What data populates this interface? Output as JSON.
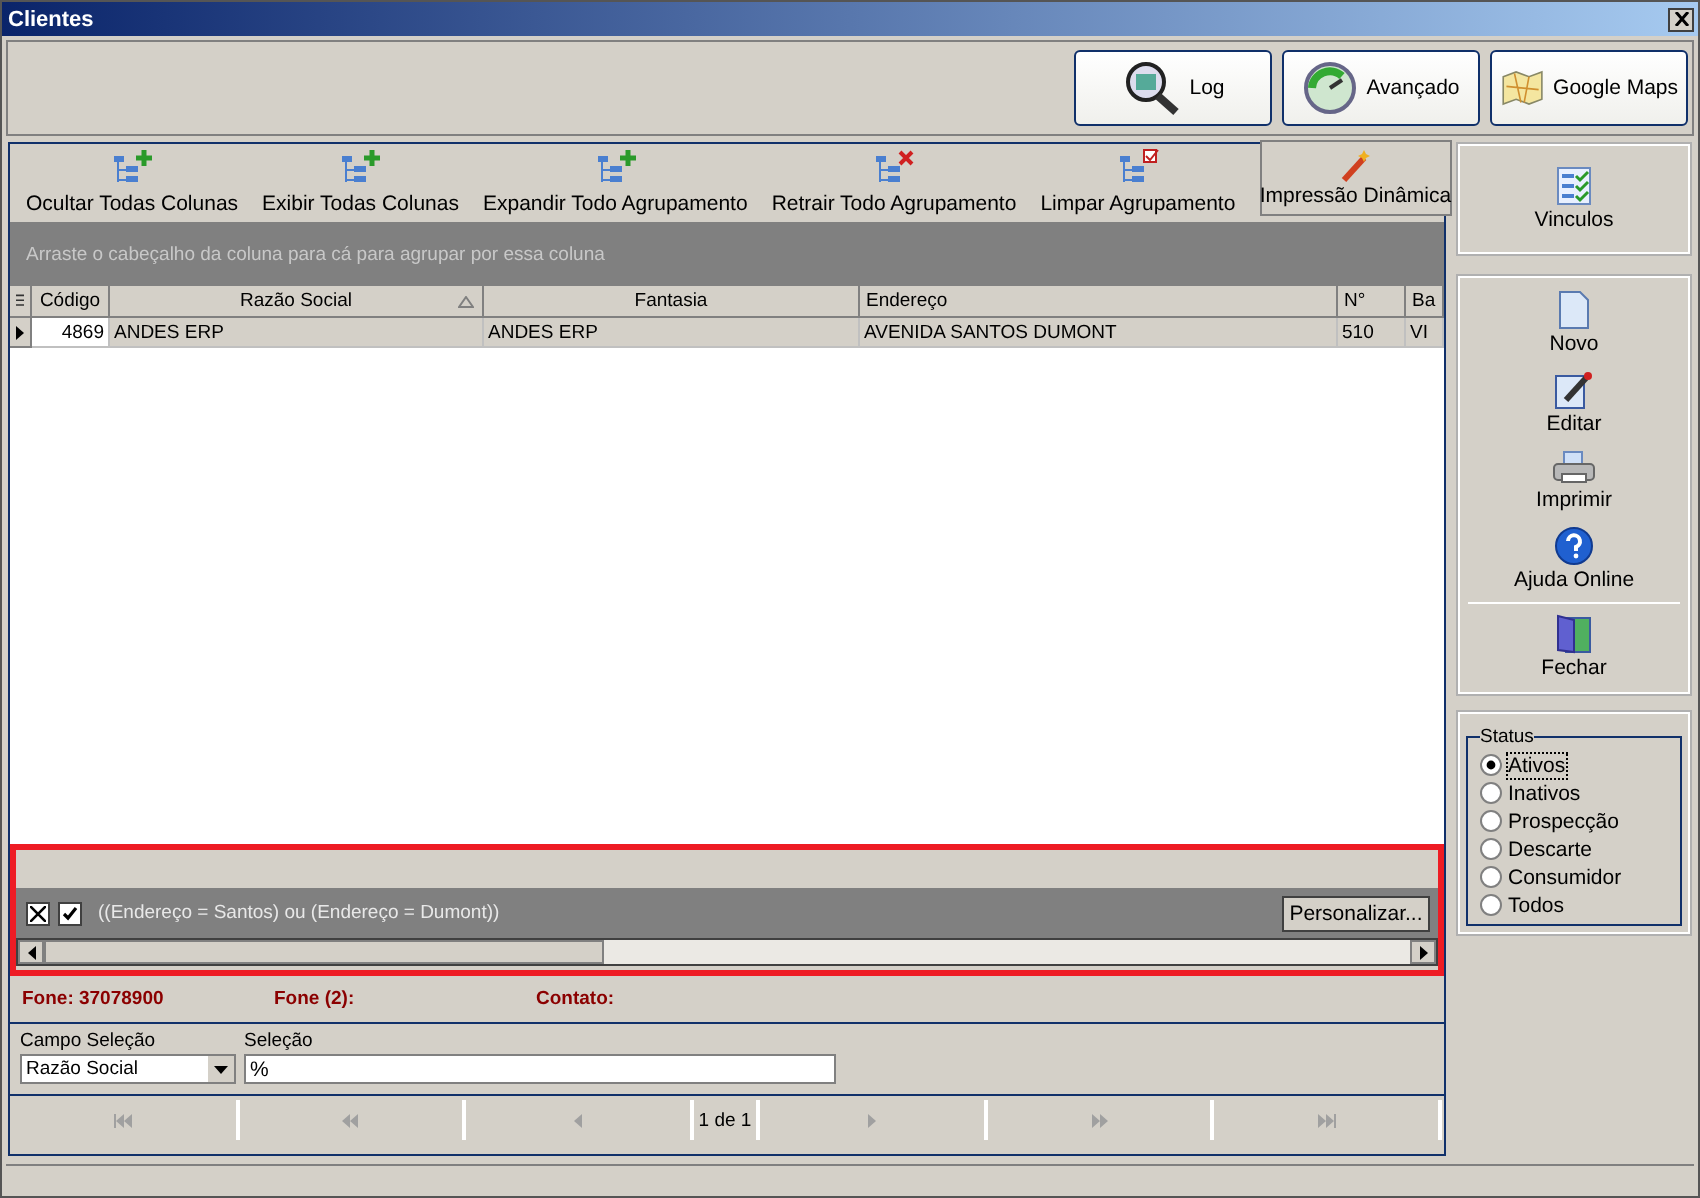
{
  "window": {
    "title": "Clientes"
  },
  "top_buttons": [
    {
      "label": "Log",
      "kind": "log"
    },
    {
      "label": "Avançado",
      "kind": "advanced"
    },
    {
      "label": "Google Maps",
      "kind": "map"
    }
  ],
  "toolbar": {
    "items": [
      {
        "label": "Ocultar Todas Colunas",
        "kind": "add"
      },
      {
        "label": "Exibir Todas  Colunas",
        "kind": "add"
      },
      {
        "label": "Expandir Todo Agrupamento",
        "kind": "add"
      },
      {
        "label": "Retrair Todo Agrupamento",
        "kind": "remove"
      },
      {
        "label": "Limpar Agrupamento",
        "kind": "clear"
      }
    ],
    "dynamic_print": "Impressão Dinâmica"
  },
  "group_panel": {
    "hint": "Arraste o cabeçalho da coluna para cá para agrupar por essa coluna"
  },
  "table": {
    "columns": [
      {
        "label": "Código",
        "sorted": false
      },
      {
        "label": "Razão Social",
        "sorted": true
      },
      {
        "label": "Fantasia",
        "sorted": false
      },
      {
        "label": "Endereço",
        "sorted": false
      },
      {
        "label": "N°",
        "sorted": false
      },
      {
        "label": "Ba",
        "sorted": false
      }
    ],
    "rows": [
      {
        "selected": true,
        "cells": [
          "4869",
          "ANDES ERP",
          "ANDES ERP",
          "AVENIDA SANTOS DUMONT",
          "510",
          "VI"
        ]
      }
    ]
  },
  "filter": {
    "enabled": true,
    "text": "((Endereço = Santos) ou (Endereço = Dumont))",
    "customize": "Personalizar..."
  },
  "info": [
    "Fone: 37078900",
    "Fone (2):",
    "Contato:"
  ],
  "search": {
    "field_label": "Campo Seleção",
    "field_value": "Razão Social",
    "selection_label": "Seleção",
    "selection_value": "%"
  },
  "navigator": {
    "page": "1 de 1"
  },
  "sidebar": {
    "links": [
      {
        "label": "Vinculos",
        "kind": "links"
      }
    ],
    "actions": [
      {
        "label": "Novo",
        "kind": "new"
      },
      {
        "label": "Editar",
        "kind": "edit"
      },
      {
        "label": "Imprimir",
        "kind": "print"
      },
      {
        "label": "Ajuda Online",
        "kind": "help"
      },
      {
        "label": "Fechar",
        "kind": "close"
      }
    ]
  },
  "status": {
    "title": "Status",
    "options": [
      {
        "label": "Ativos",
        "selected": true
      },
      {
        "label": "Inativos",
        "selected": false
      },
      {
        "label": "Prospecção",
        "selected": false
      },
      {
        "label": "Descarte",
        "selected": false
      },
      {
        "label": "Consumidor",
        "selected": false
      },
      {
        "label": "Todos",
        "selected": false
      }
    ]
  }
}
